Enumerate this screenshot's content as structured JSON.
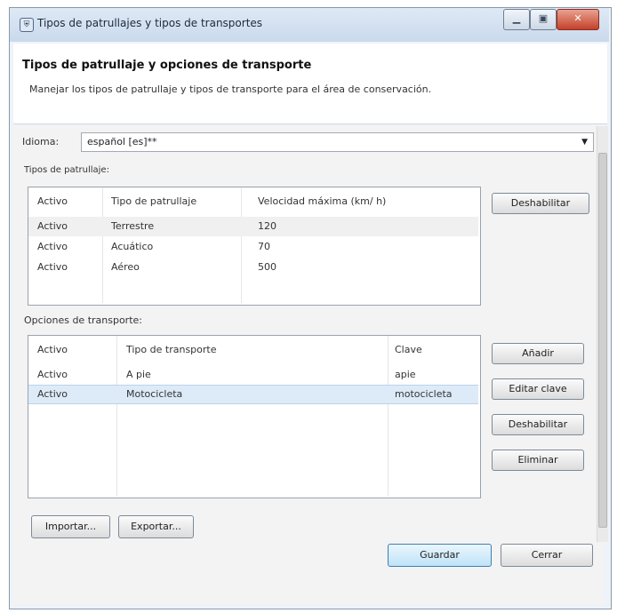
{
  "window": {
    "title": "Tipos de patrullajes y tipos de transportes",
    "icon": "shield-icon",
    "minimize": "▁",
    "maximize": "▣",
    "close": "✕"
  },
  "header": {
    "title": "Tipos de patrullaje y opciones de transporte",
    "description": "Manejar los tipos de patrullaje y tipos de transporte para el área de conservación."
  },
  "language": {
    "label": "Idioma:",
    "value": "español [es]**"
  },
  "patrol_types": {
    "section_label": "Tipos de patrullaje:",
    "columns": [
      "Activo",
      "Tipo de patrullaje",
      "Velocidad máxima (km/ h)"
    ],
    "rows": [
      [
        "Activo",
        "Terrestre",
        "120"
      ],
      [
        "Activo",
        "Acuático",
        "70"
      ],
      [
        "Activo",
        "Aéreo",
        "500"
      ]
    ],
    "disable_button": "Deshabilitar"
  },
  "transport": {
    "section_label": "Opciones de transporte:",
    "columns": [
      "Activo",
      "Tipo de transporte",
      "Clave"
    ],
    "rows": [
      [
        "Activo",
        "A pie",
        "apie"
      ],
      [
        "Activo",
        "Motocicleta",
        "motocicleta"
      ]
    ],
    "buttons": {
      "add": "Añadir",
      "edit_key": "Editar clave",
      "disable": "Deshabilitar",
      "delete": "Eliminar"
    }
  },
  "footer": {
    "import": "Importar...",
    "export": "Exportar...",
    "save": "Guardar",
    "close": "Cerrar"
  }
}
